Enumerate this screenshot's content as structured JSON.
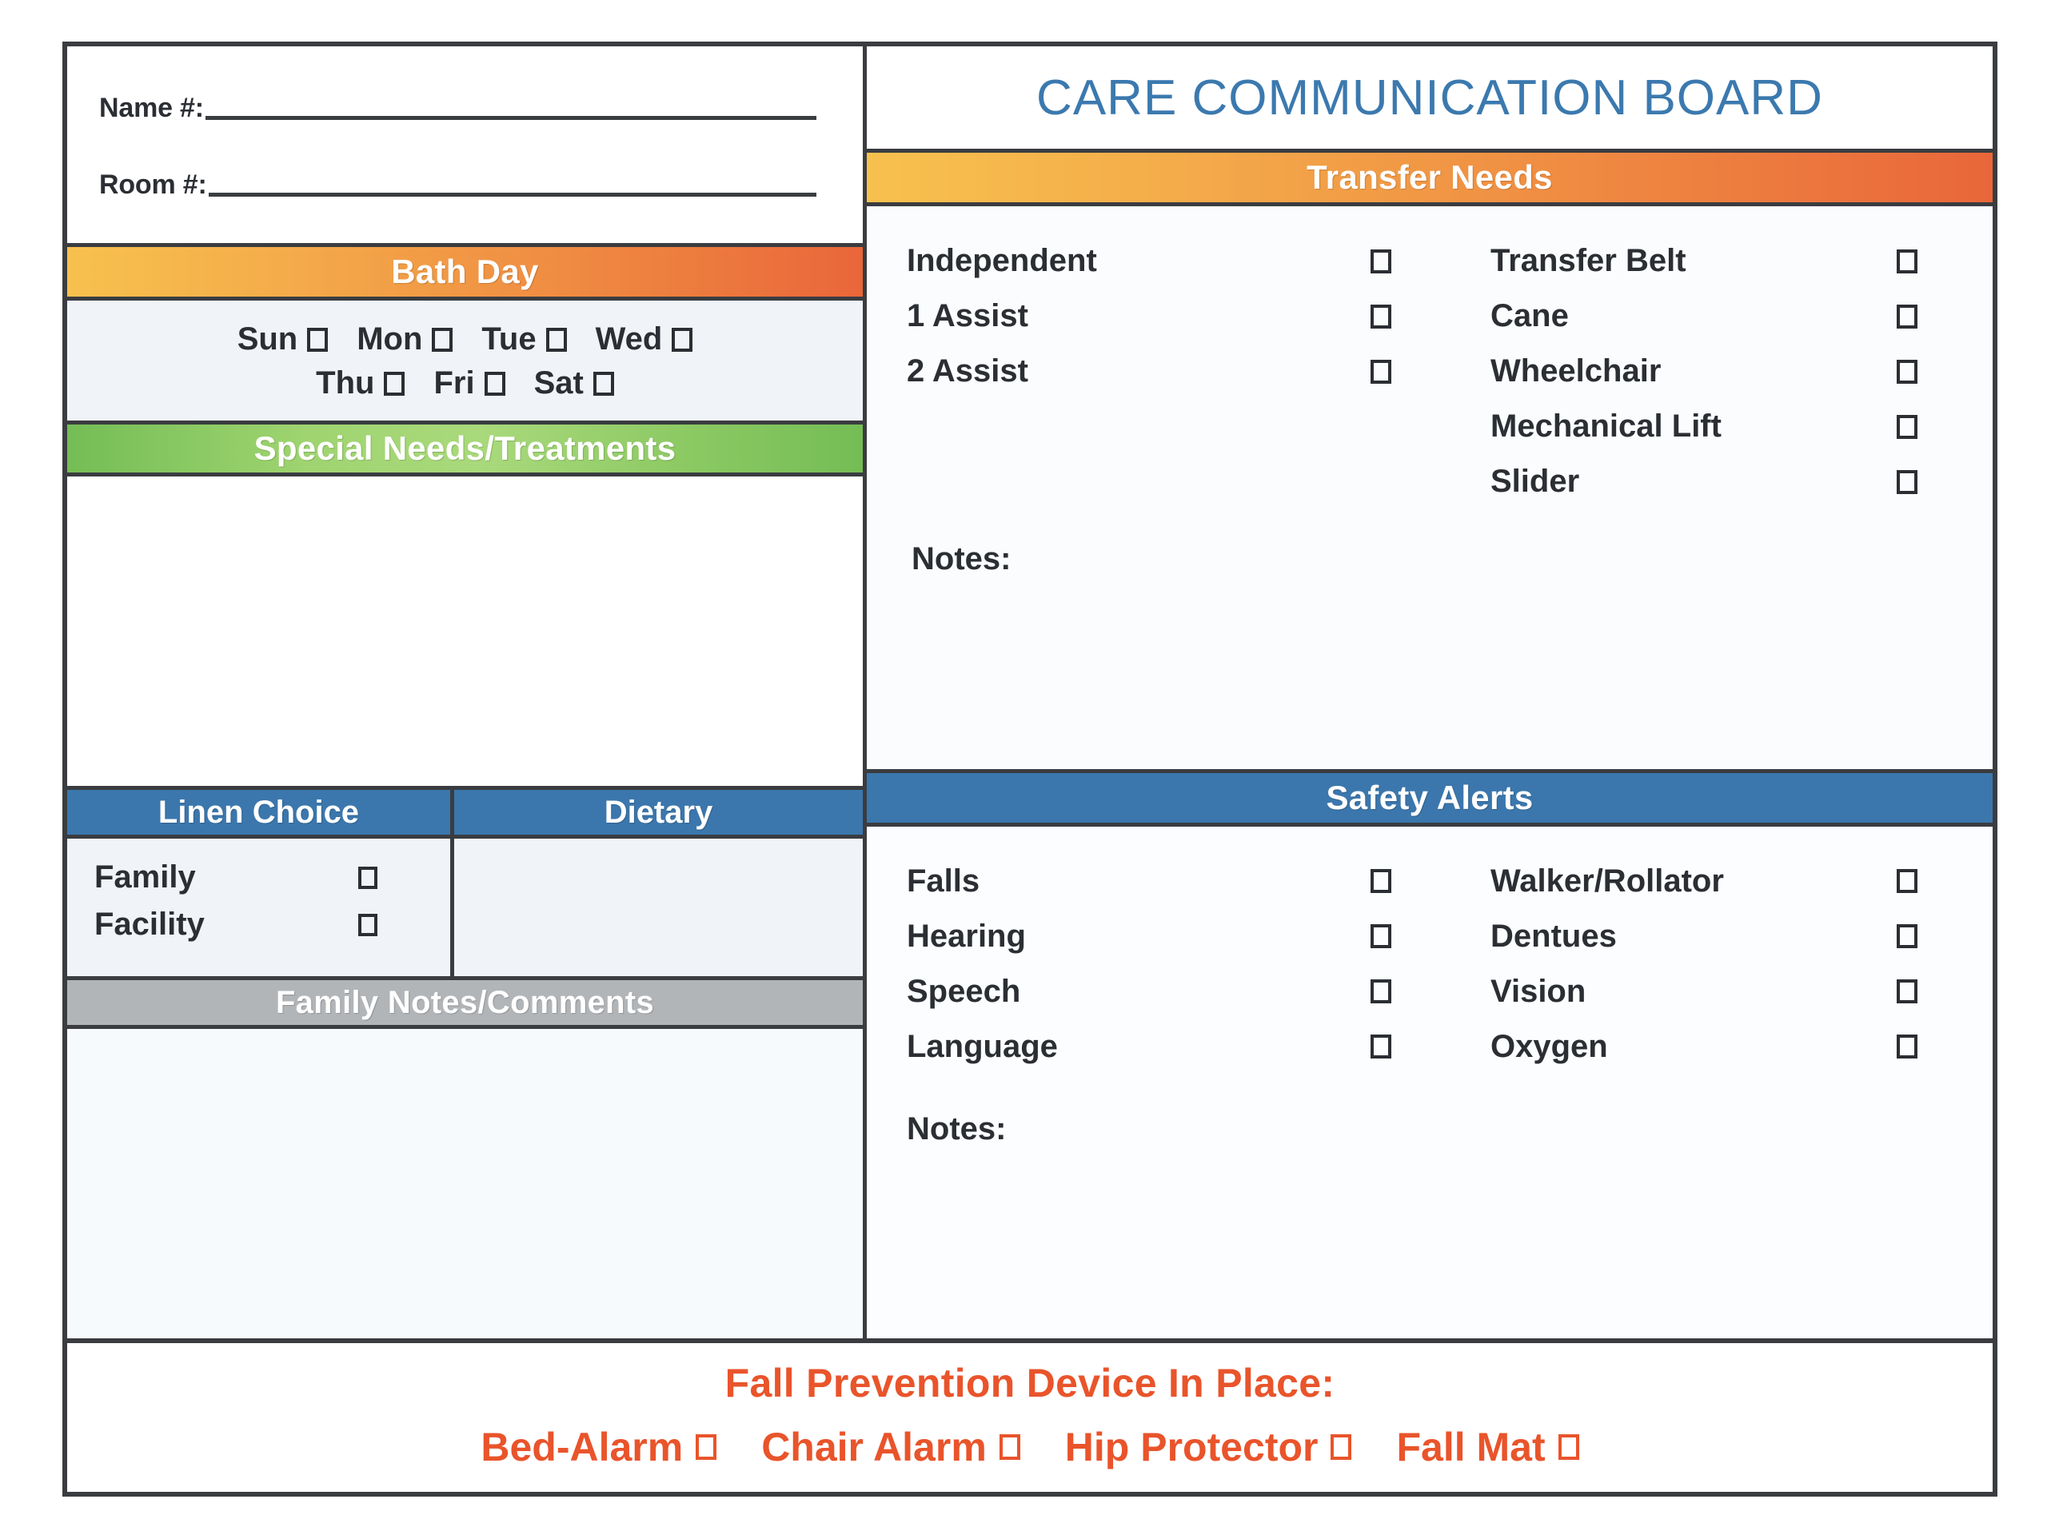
{
  "header": {
    "title": "CARE COMMUNICATION BOARD",
    "title_color": "#3b79ae"
  },
  "identification": {
    "name_label": "Name #:",
    "room_label": "Room #:"
  },
  "bath_day": {
    "header": "Bath Day",
    "header_gradient_from": "#f7c14e",
    "header_gradient_to": "#e9663a",
    "row1": [
      {
        "label": "Sun",
        "checked": false
      },
      {
        "label": "Mon",
        "checked": false
      },
      {
        "label": "Tue",
        "checked": false
      },
      {
        "label": "Wed",
        "checked": false
      }
    ],
    "row2": [
      {
        "label": "Thu",
        "checked": false
      },
      {
        "label": "Fri",
        "checked": false
      },
      {
        "label": "Sat",
        "checked": false
      }
    ]
  },
  "special_needs": {
    "header": "Special Needs/Treatments",
    "header_color": "#8cc963",
    "body_text": ""
  },
  "linen_choice": {
    "header": "Linen Choice",
    "header_color": "#3b77ad",
    "options": [
      {
        "label": "Family",
        "checked": false
      },
      {
        "label": "Facility",
        "checked": false
      }
    ]
  },
  "dietary": {
    "header": "Dietary",
    "header_color": "#3b77ad",
    "body_text": ""
  },
  "family_notes": {
    "header": "Family Notes/Comments",
    "header_color": "#b2b5b8",
    "body_text": ""
  },
  "transfer_needs": {
    "header": "Transfer Needs",
    "header_gradient_from": "#f7c14e",
    "header_gradient_to": "#e9663a",
    "column_left": [
      {
        "label": "Independent",
        "checked": false
      },
      {
        "label": "1 Assist",
        "checked": false
      },
      {
        "label": "2 Assist",
        "checked": false
      }
    ],
    "column_right": [
      {
        "label": "Transfer Belt",
        "checked": false
      },
      {
        "label": "Cane",
        "checked": false
      },
      {
        "label": "Wheelchair",
        "checked": false
      },
      {
        "label": "Mechanical Lift",
        "checked": false
      },
      {
        "label": "Slider",
        "checked": false
      }
    ],
    "notes_label": "Notes:",
    "notes_text": ""
  },
  "safety_alerts": {
    "header": "Safety Alerts",
    "header_color": "#3b77ad",
    "column_left": [
      {
        "label": "Falls",
        "checked": false
      },
      {
        "label": "Hearing",
        "checked": false
      },
      {
        "label": "Speech",
        "checked": false
      },
      {
        "label": "Language",
        "checked": false
      }
    ],
    "column_right": [
      {
        "label": "Walker/Rollator",
        "checked": false
      },
      {
        "label": "Dentues",
        "checked": false
      },
      {
        "label": "Vision",
        "checked": false
      },
      {
        "label": "Oxygen",
        "checked": false
      }
    ],
    "notes_label": "Notes:",
    "notes_text": ""
  },
  "fall_prevention": {
    "title": "Fall Prevention Device In Place:",
    "accent_color": "#e9542b",
    "options": [
      {
        "label": "Bed-Alarm",
        "checked": false
      },
      {
        "label": "Chair Alarm",
        "checked": false
      },
      {
        "label": "Hip Protector",
        "checked": false
      },
      {
        "label": "Fall Mat",
        "checked": false
      }
    ]
  }
}
